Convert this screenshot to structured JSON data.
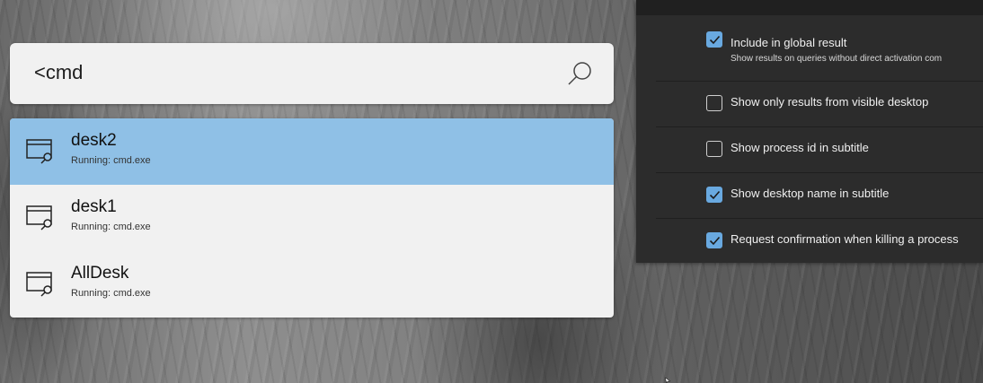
{
  "search": {
    "query": "<cmd"
  },
  "results": [
    {
      "title": "desk2",
      "subtitle": "Running: cmd.exe",
      "selected": true
    },
    {
      "title": "desk1",
      "subtitle": "Running: cmd.exe",
      "selected": false
    },
    {
      "title": "AllDesk",
      "subtitle": "Running: cmd.exe",
      "selected": false
    }
  ],
  "settings": [
    {
      "label": "Include in global result",
      "description": "Show results on queries without direct activation com",
      "checked": true
    },
    {
      "label": "Show only results from visible desktop",
      "checked": false
    },
    {
      "label": "Show process id in subtitle",
      "checked": false
    },
    {
      "label": "Show desktop name in subtitle",
      "checked": true
    },
    {
      "label": "Request confirmation when killing a process",
      "checked": true
    }
  ],
  "colors": {
    "selected_row": "#8fc0e6",
    "checkbox_accent": "#69a9e0",
    "panel_bg": "#2c2c2c"
  },
  "icons": {
    "search": "search-icon",
    "result": "window-search-icon",
    "check": "check-icon"
  }
}
